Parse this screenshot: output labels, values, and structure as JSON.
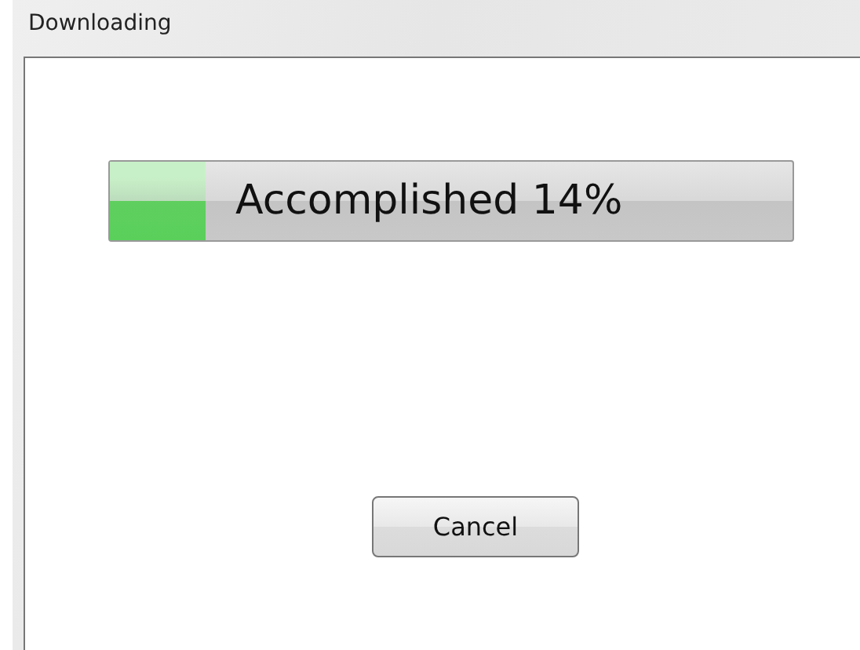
{
  "window": {
    "title": "Downloading"
  },
  "progress": {
    "label": "Accomplished 14%",
    "level": 0.14
  },
  "buttons": [
    "Cancel"
  ]
}
